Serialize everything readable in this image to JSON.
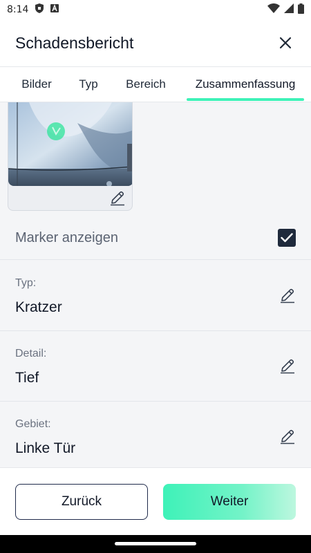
{
  "status_bar": {
    "time": "8:14",
    "icons_left": [
      "shield-icon",
      "font-a-icon"
    ],
    "icons_right": [
      "wifi-icon",
      "cellular-signal-icon",
      "battery-icon"
    ]
  },
  "header": {
    "title": "Schadensbericht",
    "close_icon": "close-icon"
  },
  "tabs": [
    {
      "label": "Bilder",
      "active": false
    },
    {
      "label": "Typ",
      "active": false
    },
    {
      "label": "Bereich",
      "active": false
    },
    {
      "label": "Zusammenfassung",
      "active": true
    }
  ],
  "summary": {
    "photo_edit_icon": "pencil-icon",
    "marker": {
      "label": "Marker anzeigen",
      "checked": true
    },
    "rows": [
      {
        "label": "Typ:",
        "value": "Kratzer"
      },
      {
        "label": "Detail:",
        "value": "Tief"
      },
      {
        "label": "Gebiet:",
        "value": "Linke Tür"
      }
    ]
  },
  "footer": {
    "back_label": "Zurück",
    "next_label": "Weiter"
  },
  "colors": {
    "accent": "#3EF2B8",
    "checkbox": "#1F2A3C",
    "content_bg": "#F4F5F7",
    "border_dark": "#1F2A4A"
  }
}
